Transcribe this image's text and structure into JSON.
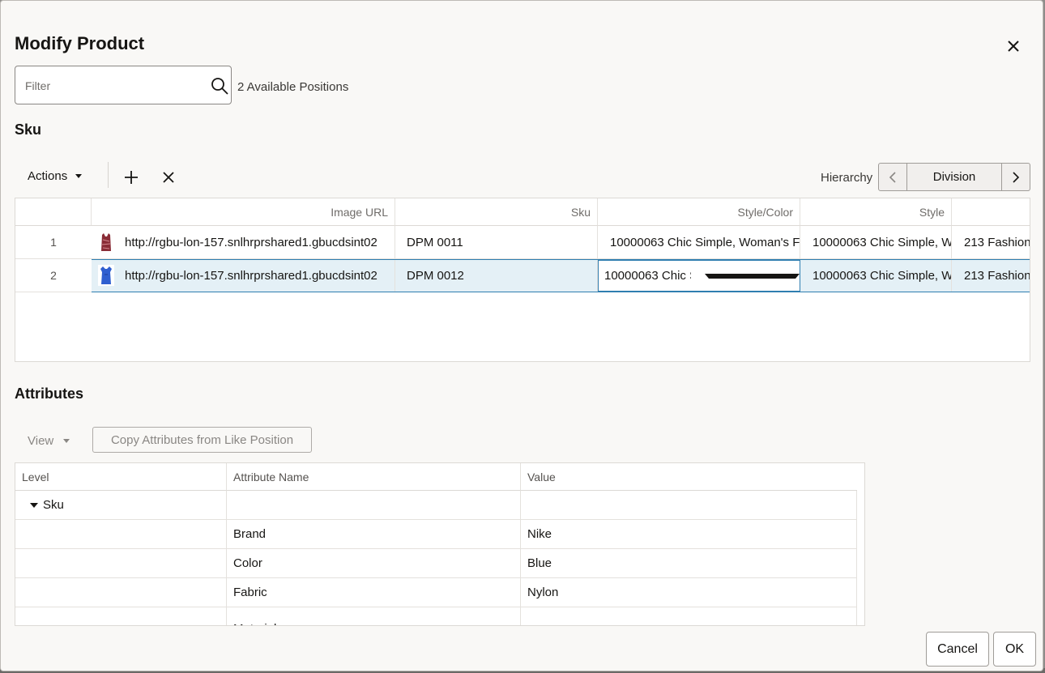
{
  "dialog": {
    "title": "Modify Product"
  },
  "filter": {
    "placeholder": "Filter",
    "available_text": "2 Available Positions"
  },
  "sku_section": {
    "title": "Sku",
    "toolbar": {
      "actions_label": "Actions"
    },
    "hierarchy": {
      "label": "Hierarchy",
      "value": "Division"
    },
    "columns": [
      "Image URL",
      "Sku",
      "Style/Color",
      "Style",
      ""
    ],
    "rows": [
      {
        "num": "1",
        "image_url": "http://rgbu-lon-157.snlhrprshared1.gbucdsint02",
        "sku": "DPM 0011",
        "style_color": "10000063 Chic Simple, Woman's F",
        "style": "10000063 Chic Simple, W",
        "extra": "213 Fashion"
      },
      {
        "num": "2",
        "image_url": "http://rgbu-lon-157.snlhrprshared1.gbucdsint02",
        "sku": "DPM 0012",
        "style_color": "10000063 Chic Simple, Wom",
        "style": "10000063 Chic Simple, W",
        "extra": "213 Fashion"
      }
    ]
  },
  "attributes_section": {
    "title": "Attributes",
    "view_label": "View",
    "copy_button": "Copy Attributes from Like Position",
    "columns": [
      "Level",
      "Attribute Name",
      "Value"
    ],
    "group_label": "Sku",
    "rows": [
      {
        "name": "Brand",
        "value": "Nike"
      },
      {
        "name": "Color",
        "value": "Blue"
      },
      {
        "name": "Fabric",
        "value": "Nylon"
      },
      {
        "name": "Material",
        "value": ""
      }
    ]
  },
  "footer": {
    "cancel": "Cancel",
    "ok": "OK"
  },
  "colors": {
    "accent": "#2f7eb0",
    "selected_row": "#e4f0f6",
    "dialog_bg": "#f9f8f6"
  }
}
